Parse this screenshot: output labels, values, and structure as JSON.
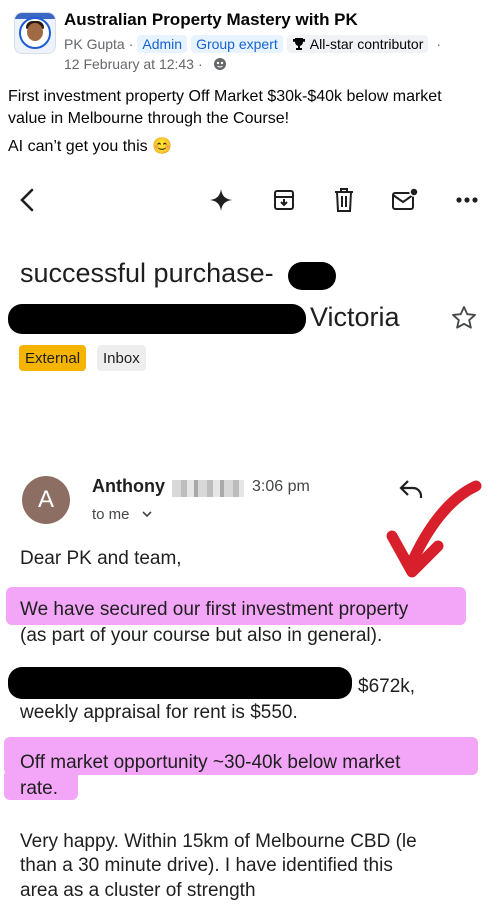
{
  "post": {
    "group_name": "Australian Property Mastery with PK",
    "author": "PK Gupta",
    "sep": "·",
    "badges": [
      "Admin",
      "Group expert",
      "All-star contributor"
    ],
    "date": "12 February at 12:43",
    "date_sep": "·",
    "text_line1": "First investment property Off Market $30k-$40k below market",
    "text_line2": "value in Melbourne through the Course!",
    "text_line3": "AI can’t get you this 😊"
  },
  "email": {
    "subject_part1": "successful purchase-",
    "subject_part2": "Victoria",
    "labels": [
      "External",
      "Inbox"
    ],
    "sender_initial": "A",
    "sender_name": "Anthony",
    "time": "3:06 pm",
    "recipient": "to me",
    "body": {
      "greeting": "Dear PK and team,",
      "line1": "We have secured our first investment property",
      "line2": "(as part of your course but also in general).",
      "price": "$672k,",
      "line4": "weekly appraisal for rent is $550.",
      "line5": "Off market opportunity ~30-40k below market",
      "line6": "rate.",
      "line7": "Very happy. Within 15km of Melbourne CBD (le",
      "line8": "than a 30 minute drive). I have identified this",
      "line9": "area as a cluster of strength"
    }
  },
  "colors": {
    "highlight": "#f3a6f7",
    "arrow": "#d8202c",
    "external_label": "#f5b400",
    "sender_avatar": "#8d6e63",
    "badge_blue": "#1763cf"
  },
  "icons": [
    "back-arrow-icon",
    "sparkle-icon",
    "archive-icon",
    "trash-icon",
    "mail-unread-icon",
    "more-icon",
    "star-icon",
    "reply-icon",
    "chevron-down-icon",
    "trophy-icon",
    "globe-icon"
  ]
}
